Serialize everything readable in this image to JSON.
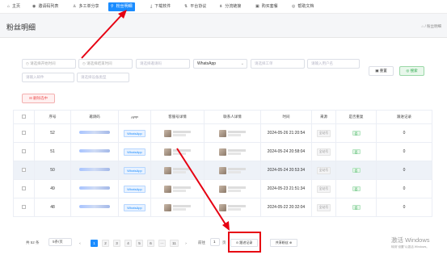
{
  "nav": {
    "items": [
      {
        "label": "主页",
        "icon": "home-icon",
        "glyph": "⌂"
      },
      {
        "label": "邀请码列表",
        "icon": "location-pin-icon",
        "glyph": "◉"
      },
      {
        "label": "多工单分享",
        "icon": "user-icon",
        "glyph": "♙"
      },
      {
        "label": "粉丝明细",
        "icon": "fans-chart-icon",
        "glyph": "⚲"
      },
      {
        "label": "下载软件",
        "icon": "download-icon",
        "glyph": "⤓"
      },
      {
        "label": "平台协议",
        "icon": "protocol-icon",
        "glyph": "⇅"
      },
      {
        "label": "分流链接",
        "icon": "share-link-icon",
        "glyph": "⋔"
      },
      {
        "label": "购买套餐",
        "icon": "package-icon",
        "glyph": "▣"
      },
      {
        "label": "帮助文档",
        "icon": "help-doc-icon",
        "glyph": "◎"
      }
    ],
    "active_index": 3
  },
  "page": {
    "title": "粉丝明细",
    "breadcrumb": "⌂ / 粉丝明细"
  },
  "filters": {
    "row1": [
      "◷ 请选择开始时间",
      "◷ 请选择结束时间",
      "请选择邀请码",
      "WhatsApp",
      "请选择工单",
      "请输入用户名"
    ],
    "row2": [
      "请输入邮件",
      "请选择设备类型"
    ],
    "app_select_value": "WhatsApp",
    "reset_label": "▣ 重置",
    "search_label": "◎ 搜索",
    "delete_selected_label": "⊟ 删除选中"
  },
  "table": {
    "headers": [
      "",
      "序号",
      "邀请码",
      "APP",
      "客服号详情",
      "联系人详情",
      "时间",
      "来源",
      "是否重复",
      "跟进记录"
    ],
    "rows": [
      {
        "index": "52",
        "app": "WhatsApp",
        "time": "2024-05-26 21:20:54",
        "source": "全站号",
        "dup": "否",
        "follow": "0"
      },
      {
        "index": "51",
        "app": "WhatsApp",
        "time": "2024-05-24 20:58:04",
        "source": "全站号",
        "dup": "否",
        "follow": "0"
      },
      {
        "index": "50",
        "app": "WhatsApp",
        "time": "2024-05-24 20:53:34",
        "source": "全站号",
        "dup": "否",
        "follow": "0"
      },
      {
        "index": "49",
        "app": "WhatsApp",
        "time": "2024-05-23 21:51:34",
        "source": "全站号",
        "dup": "否",
        "follow": "0"
      },
      {
        "index": "48",
        "app": "WhatsApp",
        "time": "2024-05-22 20:32:04",
        "source": "全站号",
        "dup": "否",
        "follow": "0"
      }
    ]
  },
  "pagination": {
    "total": "共 52 条",
    "page_size": "5条/页",
    "prev": "‹",
    "pages": [
      "1",
      "2",
      "3",
      "4",
      "5",
      "6",
      "···",
      "11"
    ],
    "active": "1",
    "next": "›",
    "goto_label": "前往",
    "goto_value": "1",
    "goto_suffix": "页"
  },
  "actions": {
    "follow_record_label": "⊙ 跟进记录",
    "export_label": "共享粉丝 ⊕"
  },
  "watermark": {
    "line1": "激活 Windows",
    "line2": "转到\"设置\"以激活 Windows。"
  },
  "colors": {
    "accent": "#1a8cff",
    "annotation_red": "#e60012"
  }
}
